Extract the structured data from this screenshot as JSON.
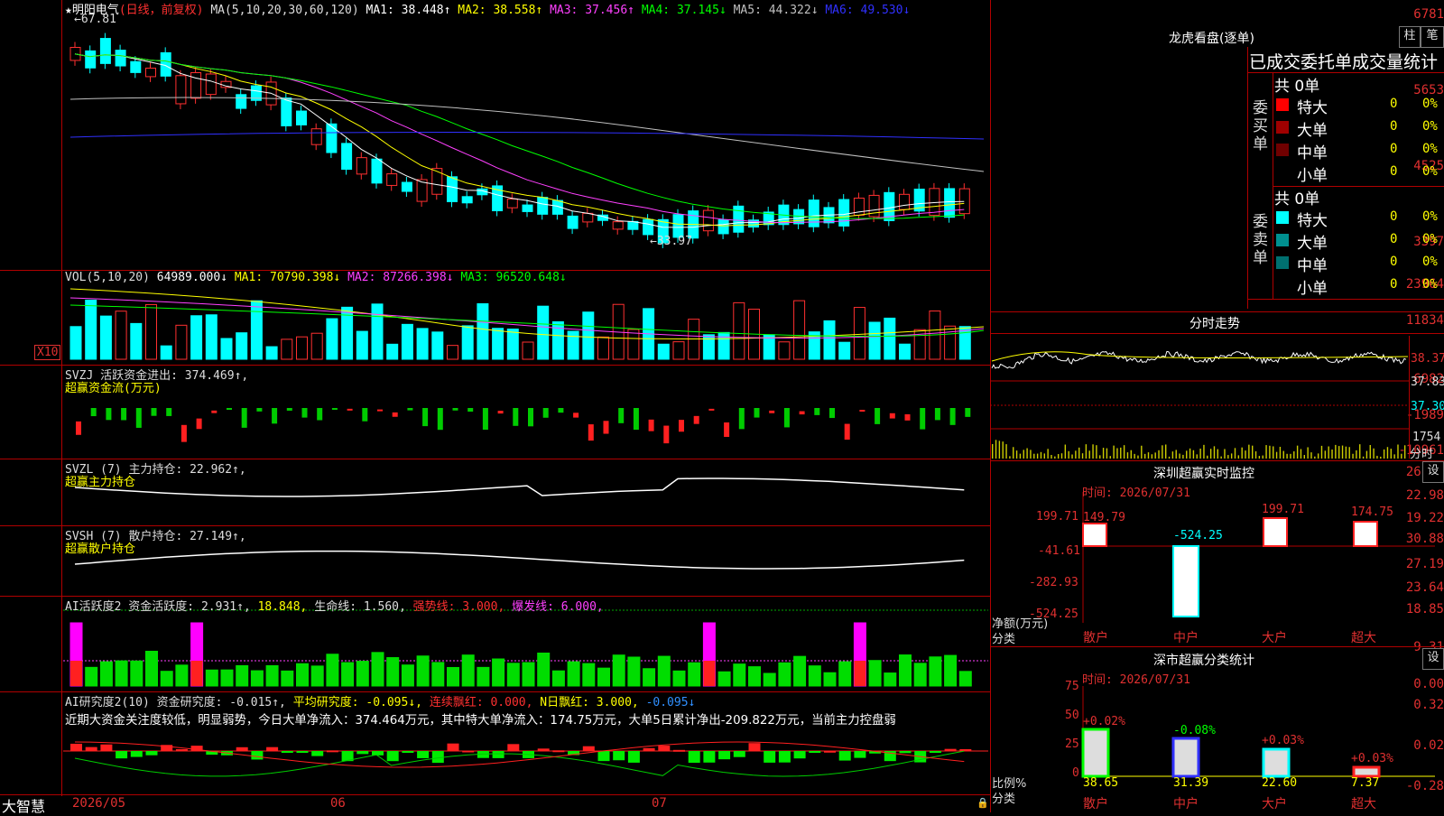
{
  "stock": {
    "star": "★",
    "name": "明阳电气",
    "period": "(日线，前复权)",
    "ma_params": "MA(5,10,20,30,60,120)"
  },
  "ma_values": [
    {
      "label": "MA1:",
      "value": "38.448",
      "arrow": "↑",
      "color": "#ffffff"
    },
    {
      "label": "MA2:",
      "value": "38.558",
      "arrow": "↑",
      "color": "#ffff00"
    },
    {
      "label": "MA3:",
      "value": "37.456",
      "arrow": "↑",
      "color": "#ff40ff"
    },
    {
      "label": "MA4:",
      "value": "37.145",
      "arrow": "↓",
      "color": "#00ff00"
    },
    {
      "label": "MA5:",
      "value": "44.322",
      "arrow": "↓",
      "color": "#c0c0c0"
    },
    {
      "label": "MA6:",
      "value": "49.530",
      "arrow": "↓",
      "color": "#3030ff"
    }
  ],
  "price_axis": [
    "6781",
    "5653",
    "4525",
    "3397"
  ],
  "price_marks": {
    "high": "67.81",
    "low": "33.97"
  },
  "vol": {
    "header": "VOL(5,10,20)",
    "value": "64989.000↓",
    "ma1": "MA1: 70790.398↓",
    "ma2": "MA2: 87266.398↓",
    "ma3": "MA3: 96520.648↓",
    "axis": [
      "23964",
      "11834"
    ],
    "unit": "X10"
  },
  "svzj": {
    "header": "SVZJ  活跃资金进出: 374.469↑,",
    "sub": "超赢资金流(万元)",
    "axis": [
      "6982",
      "-1989",
      "-10961"
    ]
  },
  "svzl": {
    "header": "SVZL (7) 主力持仓: 22.962↑,",
    "sub": "超赢主力持仓",
    "axis": [
      "26.73",
      "22.98",
      "19.22"
    ]
  },
  "svsh": {
    "header": "SVSH (7) 散户持仓: 27.149↑,",
    "sub": "超赢散户持仓",
    "axis": [
      "30.88",
      "27.19",
      "23.64"
    ]
  },
  "ai1": {
    "header": "AI活跃度2 资金活跃度: 2.931↑,",
    "v2": "18.848,",
    "v3": "生命线: 1.560,",
    "v4": "强势线: 3.000,",
    "v5": "爆发线: 6.000,",
    "axis": [
      "18.85",
      "9.31",
      "0.00"
    ]
  },
  "ai2": {
    "header": "AI研究度2(10) 资金研究度: -0.015↑,",
    "v2": "平均研究度: -0.095↓,",
    "v3": "连续飘红: 0.000,",
    "v4": "N日飘红: 3.000,",
    "v5": "-0.095↓",
    "axis": [
      "0.32",
      "0.02",
      "-0.28"
    ],
    "comment": "近期大资金关注度较低，明显弱势，今日大单净流入：374.464万元，其中特大单净流入：174.75万元，大单5日累计净出-209.822万元，当前主力控盘弱"
  },
  "bottom": {
    "brand": "大智慧",
    "dates": [
      "2026/05",
      "06",
      "07"
    ]
  },
  "lhb": {
    "title": "龙虎看盘(逐单)",
    "btn1": "柱",
    "btn2": "笔",
    "subtitle": "已成交委托单成交量统计",
    "buy": {
      "side": "委买单",
      "total": "共 0单",
      "rows": [
        {
          "name": "特大",
          "count": "0",
          "pct": "0%",
          "color": "#ff0000"
        },
        {
          "name": "大单",
          "count": "0",
          "pct": "0%",
          "color": "#a00000"
        },
        {
          "name": "中单",
          "count": "0",
          "pct": "0%",
          "color": "#700000"
        },
        {
          "name": "小单",
          "count": "0",
          "pct": "0%",
          "color": "#000000"
        }
      ]
    },
    "sell": {
      "side": "委卖单",
      "total": "共 0单",
      "rows": [
        {
          "name": "特大",
          "count": "0",
          "pct": "0%",
          "color": "#00ffff"
        },
        {
          "name": "大单",
          "count": "0",
          "pct": "0%",
          "color": "#009090"
        },
        {
          "name": "中单",
          "count": "0",
          "pct": "0%",
          "color": "#007070"
        },
        {
          "name": "小单",
          "count": "0",
          "pct": "0%",
          "color": "#000000"
        }
      ]
    }
  },
  "intraday": {
    "title": "分时走势",
    "axis": [
      "38.37",
      "37.83",
      "37.30"
    ],
    "vol_axis": "1754",
    "unit": "分时"
  },
  "monitor": {
    "title": "深圳超赢实时监控",
    "btn": "设",
    "time": "时间: 2026/07/31",
    "axis": [
      "199.71",
      "-41.61",
      "-282.93",
      "-524.25"
    ],
    "ylabel": "净额(万元)",
    "xlabel": "分类",
    "cats": [
      "散户",
      "中户",
      "大户",
      "超大"
    ],
    "labels": [
      "149.79",
      "-524.25",
      "199.71",
      "174.75"
    ]
  },
  "classify": {
    "title": "深市超赢分类统计",
    "btn": "设",
    "time": "时间: 2026/07/31",
    "axis": [
      "75",
      "50",
      "25",
      "0"
    ],
    "ylabel": "比例%",
    "xlabel": "分类",
    "cats": [
      "散户",
      "中户",
      "大户",
      "超大"
    ],
    "values": [
      "38.65",
      "31.39",
      "22.60",
      "7.37"
    ],
    "changes": [
      "+0.02%",
      "-0.08%",
      "+0.03%",
      "+0.03%"
    ]
  }
}
